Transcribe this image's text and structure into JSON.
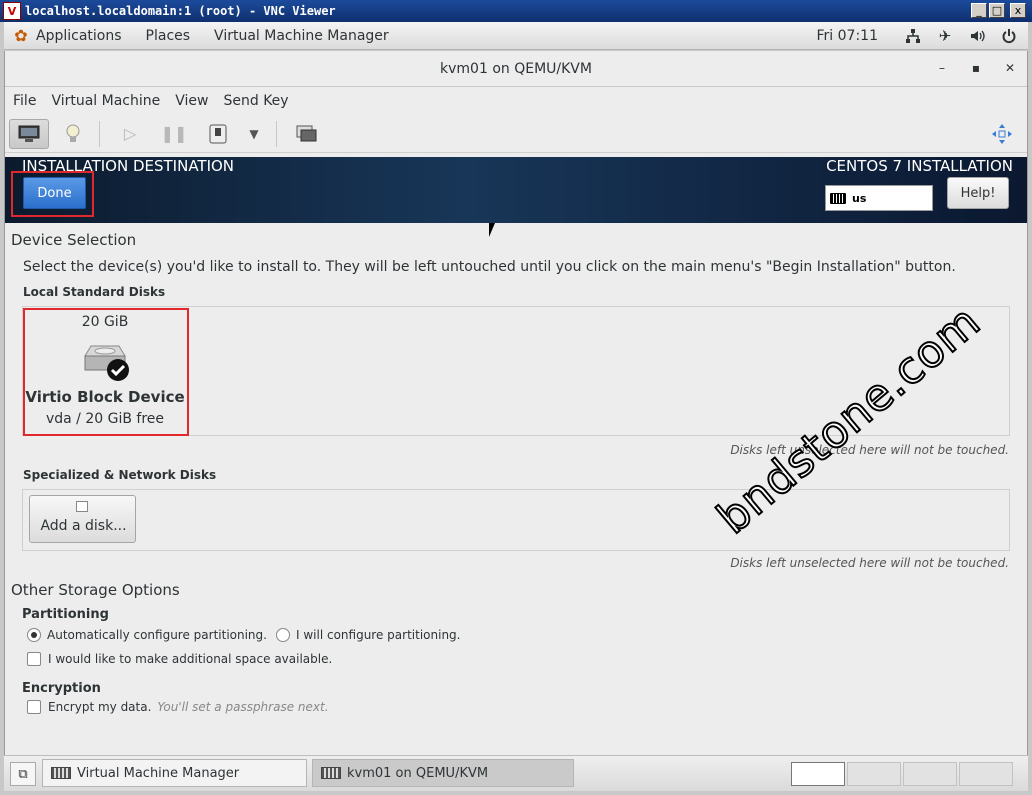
{
  "vnc": {
    "title": "localhost.localdomain:1 (root) - VNC Viewer",
    "logo": "V",
    "controls": [
      "_",
      "□",
      "x"
    ]
  },
  "gnome": {
    "menus": [
      "Applications",
      "Places",
      "Virtual Machine Manager"
    ],
    "clock": "Fri 07:11",
    "tray_icons": [
      "network-icon",
      "airplane-icon",
      "volume-icon",
      "power-icon"
    ]
  },
  "vm_window": {
    "title": "kvm01 on QEMU/KVM",
    "controls": [
      "–",
      "▪",
      "✕"
    ],
    "menu": [
      "File",
      "Virtual Machine",
      "View",
      "Send Key"
    ]
  },
  "installer": {
    "spoke_title": "INSTALLATION DESTINATION",
    "product": "CENTOS 7 INSTALLATION",
    "done_label": "Done",
    "keyboard_layout": "us",
    "help_label": "Help!",
    "device_selection": "Device Selection",
    "instructions": "Select the device(s) you'd like to install to.  They will be left untouched until you click on the main menu's \"Begin Installation\" button.",
    "local_disks_title": "Local Standard Disks",
    "disk": {
      "size": "20 GiB",
      "name": "Virtio Block Device",
      "free": "vda  /  20 GiB free"
    },
    "untouched_note": "Disks left unselected here will not be touched.",
    "network_disks_title": "Specialized & Network Disks",
    "add_disk_label": "Add a disk...",
    "untouched_note2": "Disks left unselected here will not be touched.",
    "other_options": "Other Storage Options",
    "partitioning_title": "Partitioning",
    "auto_partition": "Automatically configure partitioning.",
    "manual_partition": "I will configure partitioning.",
    "extra_space": "I would like to make additional space available.",
    "encryption_title": "Encryption",
    "encrypt_label": "Encrypt my data.",
    "encrypt_hint": "You'll set a passphrase next."
  },
  "watermark": "bndstone.com",
  "taskbar": {
    "items": [
      "Virtual Machine Manager",
      "kvm01 on QEMU/KVM"
    ]
  }
}
